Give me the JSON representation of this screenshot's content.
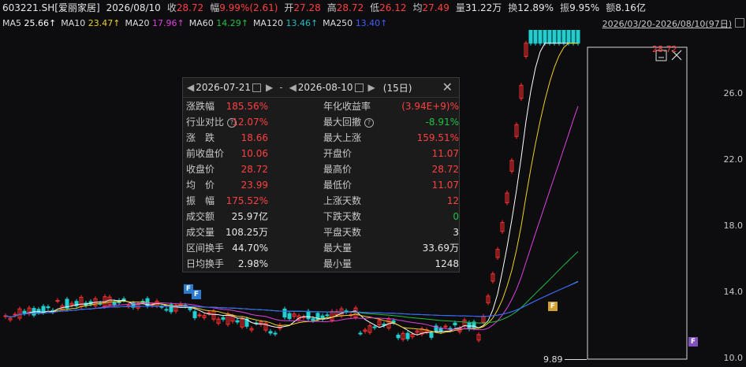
{
  "header": {
    "symbol": "603221.SH[爱丽家居]",
    "date": "2026/08/10",
    "close_label": "收",
    "close": "28.72",
    "change_label": "幅",
    "change": "9.99%(2.61)",
    "open_label": "开",
    "open": "27.28",
    "high_label": "高",
    "high": "28.72",
    "low_label": "低",
    "low": "26.12",
    "avg_label": "均",
    "avg": "27.49",
    "vol_label": "量",
    "vol": "31.22万",
    "turn_label": "换",
    "turn": "12.89%",
    "amp_label": "振",
    "amp": "9.95%",
    "amt_label": "额",
    "amt": "8.16亿"
  },
  "ma": {
    "ma5_label": "MA5",
    "ma5": "25.66↑",
    "ma10_label": "MA10",
    "ma10": "23.47↑",
    "ma20_label": "MA20",
    "ma20": "17.96↑",
    "ma60_label": "MA60",
    "ma60": "14.29↑",
    "ma120_label": "MA120",
    "ma120": "13.46↑",
    "ma250_label": "MA250",
    "ma250": "13.40↑",
    "range": "2026/03/20-2026/08/10(97日)"
  },
  "colors": {
    "ma5": "#ffffff",
    "ma10": "#f0d020",
    "ma20": "#e040e0",
    "ma60": "#20c040",
    "ma120": "#20c0c0",
    "ma250": "#4060ff",
    "up": "#ff3030",
    "down": "#20d0d0"
  },
  "y_axis": [
    "26.0",
    "22.0",
    "18.0",
    "14.0",
    "10.0"
  ],
  "price_labels": {
    "low": "9.89",
    "high": "28.72"
  },
  "markers": [
    "F",
    "F",
    "F",
    "F"
  ],
  "popup": {
    "start_date": "2026-07-21",
    "separator": "-",
    "end_date": "2026-08-10",
    "days": "(15日)",
    "rows_left": [
      {
        "k": "涨跌幅",
        "v": "185.56%",
        "c": "red"
      },
      {
        "k": "行业对比",
        "v": "12.07%",
        "c": "red",
        "help": "?"
      },
      {
        "k": "涨　跌",
        "v": "18.66",
        "c": "red"
      },
      {
        "k": "前收盘价",
        "v": "10.06",
        "c": "red"
      },
      {
        "k": "收盘价",
        "v": "28.72",
        "c": "red"
      },
      {
        "k": "均　价",
        "v": "23.99",
        "c": "red"
      },
      {
        "k": "振　幅",
        "v": "175.52%",
        "c": "red"
      },
      {
        "k": "成交额",
        "v": "25.97亿",
        "c": "wht"
      },
      {
        "k": "成交量",
        "v": "108.25万",
        "c": "wht"
      },
      {
        "k": "区间换手",
        "v": "44.70%",
        "c": "wht"
      },
      {
        "k": "日均换手",
        "v": "2.98%",
        "c": "wht"
      }
    ],
    "rows_right": [
      {
        "k": "年化收益率",
        "v": "(3.94E+9)%",
        "c": "red"
      },
      {
        "k": "最大回撤",
        "v": "-8.91%",
        "c": "grn",
        "help": "?"
      },
      {
        "k": "最大上涨",
        "v": "159.51%",
        "c": "red"
      },
      {
        "k": "开盘价",
        "v": "11.07",
        "c": "red"
      },
      {
        "k": "最高价",
        "v": "28.72",
        "c": "red"
      },
      {
        "k": "最低价",
        "v": "11.07",
        "c": "red"
      },
      {
        "k": "上涨天数",
        "v": "12",
        "c": "red"
      },
      {
        "k": "下跌天数",
        "v": "0",
        "c": "grn"
      },
      {
        "k": "平盘天数",
        "v": "3",
        "c": "wht"
      },
      {
        "k": "最大量",
        "v": "33.69万",
        "c": "wht"
      },
      {
        "k": "最小量",
        "v": "1248",
        "c": "wht"
      }
    ]
  }
}
